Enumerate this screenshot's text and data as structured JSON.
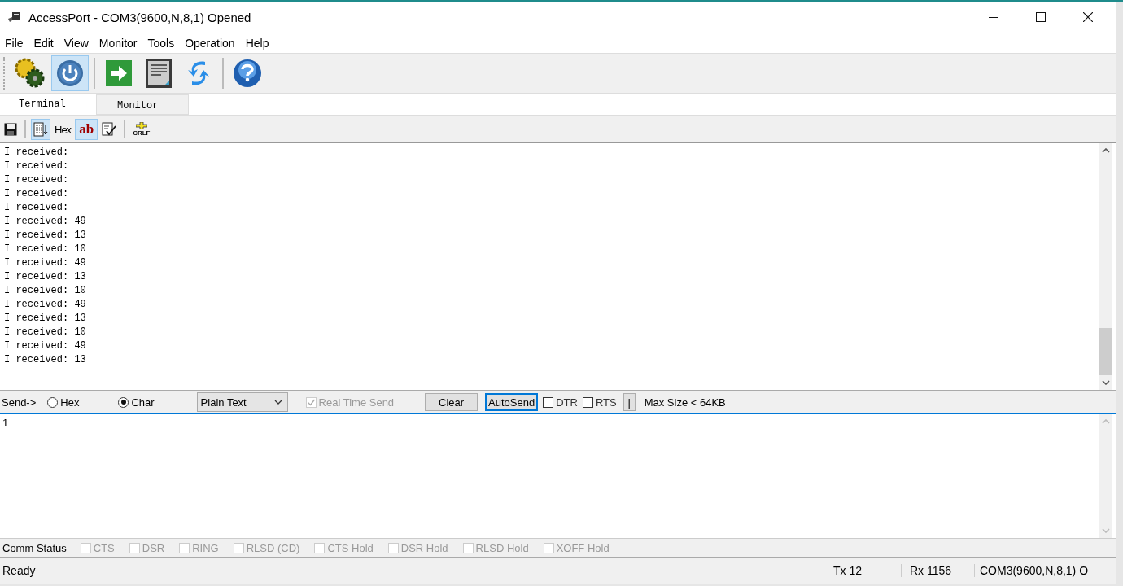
{
  "window": {
    "title": "AccessPort - COM3(9600,N,8,1) Opened"
  },
  "menu": [
    "File",
    "Edit",
    "View",
    "Monitor",
    "Tools",
    "Operation",
    "Help"
  ],
  "toolbar": [
    {
      "kind": "gears",
      "pressed": false
    },
    {
      "kind": "power",
      "pressed": true
    },
    {
      "kind": "sep"
    },
    {
      "kind": "send",
      "pressed": false
    },
    {
      "kind": "doc",
      "pressed": false
    },
    {
      "kind": "refresh",
      "pressed": false
    },
    {
      "kind": "sep"
    },
    {
      "kind": "help",
      "pressed": false
    }
  ],
  "tabs": [
    {
      "label": "Terminal",
      "selected": true
    },
    {
      "label": "Monitor",
      "selected": false
    }
  ],
  "subtoolbar": [
    {
      "kind": "save",
      "pressed": false
    },
    {
      "kind": "sep"
    },
    {
      "kind": "scroll",
      "pressed": true
    },
    {
      "kind": "text",
      "label": "Hex",
      "pressed": false
    },
    {
      "kind": "ab",
      "label": "ab",
      "pressed": true
    },
    {
      "kind": "edit",
      "pressed": false
    },
    {
      "kind": "sep"
    },
    {
      "kind": "crlf",
      "label": "CRLF",
      "pressed": false
    }
  ],
  "terminal": {
    "lines": [
      "I received:",
      "I received:",
      "I received:",
      "I received:",
      "I received:",
      "I received: 49",
      "I received: 13",
      "I received: 10",
      "I received: 49",
      "I received: 13",
      "I received: 10",
      "I received: 49",
      "I received: 13",
      "I received: 10",
      "I received: 49",
      "I received: 13"
    ]
  },
  "send_bar": {
    "label": "Send->",
    "radios": [
      {
        "label": "Hex",
        "selected": false
      },
      {
        "label": "Char",
        "selected": true
      }
    ],
    "format": "Plain Text",
    "real_time_send": {
      "label": "Real Time Send",
      "checked": true,
      "disabled": true
    },
    "clear": "Clear",
    "autosend": "AutoSend",
    "checks": [
      {
        "label": "DTR",
        "checked": false
      },
      {
        "label": "RTS",
        "checked": false
      }
    ],
    "small_button": "|",
    "max_size": "Max Size < 64KB"
  },
  "input": {
    "value": "1"
  },
  "comm_status": {
    "label": "Comm Status",
    "items": [
      {
        "label": "CTS",
        "checked": false,
        "disabled": true
      },
      {
        "label": "DSR",
        "checked": false,
        "disabled": true
      },
      {
        "label": "RING",
        "checked": false,
        "disabled": true
      },
      {
        "label": "RLSD (CD)",
        "checked": false,
        "disabled": true
      },
      {
        "label": "CTS Hold",
        "checked": false,
        "disabled": true
      },
      {
        "label": "DSR Hold",
        "checked": false,
        "disabled": true
      },
      {
        "label": "RLSD Hold",
        "checked": false,
        "disabled": true
      },
      {
        "label": "XOFF Hold",
        "checked": false,
        "disabled": true
      }
    ]
  },
  "status_bar": {
    "message": "Ready",
    "tx": "Tx 12",
    "rx": "Rx 1156",
    "port": "COM3(9600,N,8,1) O"
  }
}
